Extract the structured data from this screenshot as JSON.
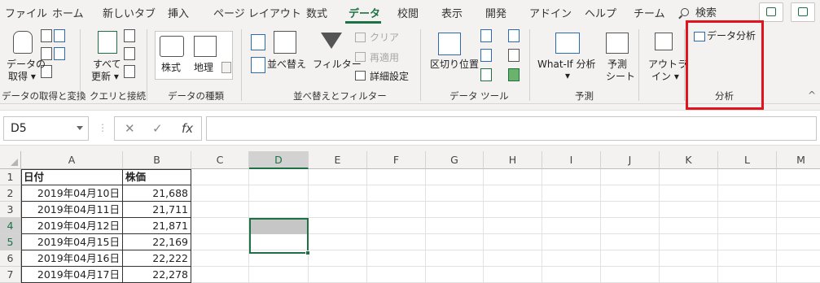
{
  "menu": {
    "tabs": [
      "ファイル",
      "ホーム",
      "新しいタブ",
      "挿入",
      "ページ レイアウト",
      "数式",
      "データ",
      "校閲",
      "表示",
      "開発",
      "アドイン",
      "ヘルプ",
      "チーム"
    ],
    "active_tab": "データ",
    "search_label": "検索"
  },
  "ribbon": {
    "get_data": {
      "label1": "データの",
      "label2": "取得 ▾",
      "group": "データの取得と変換"
    },
    "refresh": {
      "label1": "すべて",
      "label2": "更新 ▾",
      "group": "クエリと接続"
    },
    "data_types": {
      "stock": "株式",
      "geo": "地理",
      "group": "データの種類"
    },
    "sort": {
      "sort_label": "並べ替え",
      "filter_label": "フィルター",
      "clear_label": "クリア",
      "reapply_label": "再適用",
      "advanced_label": "詳細設定",
      "group": "並べ替えとフィルター"
    },
    "data_tools": {
      "text_to_columns": "区切り位置",
      "group": "データ ツール"
    },
    "forecast": {
      "whatif": "What-If 分析",
      "whatif_arrow": "▾",
      "forecast1": "予測",
      "forecast2": "シート",
      "group": "予測"
    },
    "outline": {
      "label1": "アウトラ",
      "label2": "イン ▾"
    },
    "analysis": {
      "data_analysis": "データ分析",
      "group": "分析"
    }
  },
  "formula_bar": {
    "name_box": "D5",
    "cancel": "✕",
    "enter": "✓",
    "fx": "fx",
    "formula": ""
  },
  "sheet": {
    "columns": [
      "A",
      "B",
      "C",
      "D",
      "E",
      "F",
      "G",
      "H",
      "I",
      "J",
      "K",
      "L",
      "M"
    ],
    "rows": [
      "1",
      "2",
      "3",
      "4",
      "5",
      "6",
      "7"
    ],
    "header": [
      "日付",
      "株価"
    ],
    "data": [
      [
        "2019年04月10日",
        "21,688"
      ],
      [
        "2019年04月11日",
        "21,711"
      ],
      [
        "2019年04月12日",
        "21,871"
      ],
      [
        "2019年04月15日",
        "22,169"
      ],
      [
        "2019年04月16日",
        "22,222"
      ],
      [
        "2019年04月17日",
        "22,278"
      ]
    ]
  },
  "colors": {
    "accent": "#1e7145",
    "highlight": "#e0141e"
  }
}
